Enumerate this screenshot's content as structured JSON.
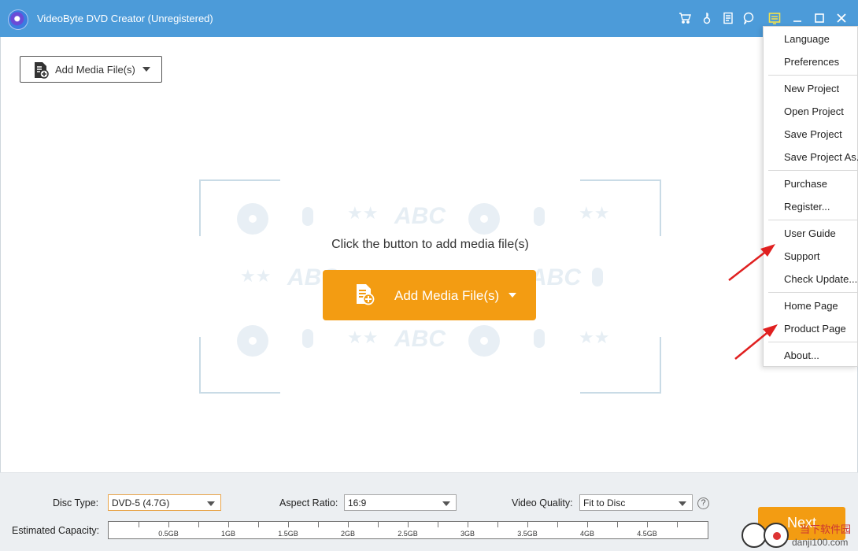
{
  "window": {
    "title": "VideoByte DVD Creator (Unregistered)",
    "toolbar_icons": [
      "cart-icon",
      "key-icon",
      "document-icon",
      "chat-icon",
      "menu-icon",
      "minimize-icon",
      "maximize-icon",
      "close-icon"
    ]
  },
  "toolbar": {
    "add_media_label": "Add Media File(s)"
  },
  "center": {
    "prompt": "Click the button to add media file(s)",
    "add_media_label": "Add Media File(s)",
    "watermark_text": "ABC"
  },
  "menu": {
    "items": [
      "Language",
      "Preferences",
      "New Project",
      "Open Project",
      "Save Project",
      "Save Project As...",
      "Purchase",
      "Register...",
      "User Guide",
      "Support",
      "Check Update...",
      "Home Page",
      "Product Page",
      "About..."
    ]
  },
  "bottom": {
    "disc_type_label": "Disc Type:",
    "disc_type_value": "DVD-5 (4.7G)",
    "aspect_ratio_label": "Aspect Ratio:",
    "aspect_ratio_value": "16:9",
    "video_quality_label": "Video Quality:",
    "video_quality_value": "Fit to Disc",
    "help": "?",
    "capacity_label": "Estimated Capacity:",
    "capacity_ticks": [
      "0.5GB",
      "1GB",
      "1.5GB",
      "2GB",
      "2.5GB",
      "3GB",
      "3.5GB",
      "4GB",
      "4.5GB"
    ],
    "next_label": "Next"
  },
  "site_watermark": {
    "url": "danji100.com",
    "cn": "当下软件园"
  },
  "colors": {
    "titlebar": "#4c9bd9",
    "accent": "#f39c12",
    "annotation_arrow": "#e02020"
  }
}
